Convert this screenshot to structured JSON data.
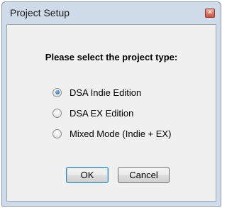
{
  "window": {
    "title": "Project Setup",
    "close_glyph": "✕"
  },
  "dialog": {
    "heading": "Please select the project type:",
    "options": [
      {
        "label": "DSA Indie Edition",
        "checked": true
      },
      {
        "label": "DSA EX Edition",
        "checked": false
      },
      {
        "label": "Mixed Mode (Indie + EX)",
        "checked": false
      }
    ],
    "ok_label": "OK",
    "cancel_label": "Cancel"
  },
  "colors": {
    "frame": "#cfdbe9",
    "client": "#f0f0f0",
    "close_button": "#c8553f",
    "radio_selected": "#2c7cc3"
  },
  "icons": {
    "close": "close-icon",
    "radio_selected": "radio-checked-icon",
    "radio_unselected": "radio-unchecked-icon"
  }
}
